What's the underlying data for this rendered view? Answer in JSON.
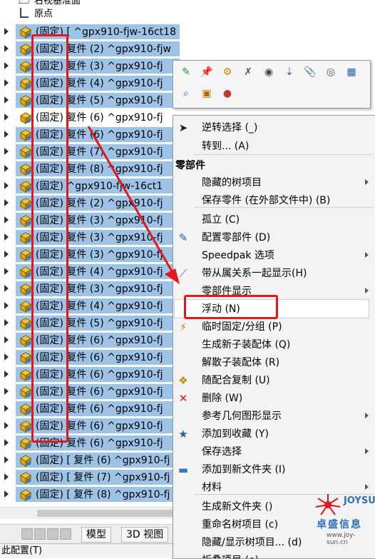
{
  "tree": {
    "top_items": [
      "右视基准面",
      "原点"
    ],
    "rows": [
      {
        "label": "(固定) [ ^gpx910-fjw-16ct18",
        "selected": true
      },
      {
        "label": "(固定)   复件 (2) ^gpx910-fjw",
        "selected": true
      },
      {
        "label": "(固定)   复件 (3) ^gpx910-fj",
        "selected": true
      },
      {
        "label": "(固定)   复件 (4) ^gpx910-fj",
        "selected": true
      },
      {
        "label": "(固定)   复件 (5) ^gpx910-fj",
        "selected": true
      },
      {
        "label": "(固定)   复件 (6) ^gpx910-fj",
        "selected": false
      },
      {
        "label": "(固定)   复件 (6) ^gpx910-fj",
        "selected": true
      },
      {
        "label": "(固定)   复件 (7) ^gpx910-fj",
        "selected": true
      },
      {
        "label": "(固定)   复件 (8) ^gpx910-fj",
        "selected": true
      },
      {
        "label": "(固定)   ^gpx910-fjw-16ct1",
        "selected": true
      },
      {
        "label": "(固定)   复件 (2) ^gpx910-fj",
        "selected": true
      },
      {
        "label": "(固定)   复件 (3) ^gpx910-fj",
        "selected": true
      },
      {
        "label": "(固定)   复件 (3) ^gpx910-fj",
        "selected": true
      },
      {
        "label": "(固定)   复件 (3) ^gpx910-fj",
        "selected": true
      },
      {
        "label": "(固定)   复件 (4) ^gpx910-fj",
        "selected": true
      },
      {
        "label": "(固定)   复件 (3) ^gpx910-fj",
        "selected": true
      },
      {
        "label": "(固定)   复件 (4) ^gpx910-fj",
        "selected": true
      },
      {
        "label": "(固定)   复件 (5) ^gpx910-fj",
        "selected": true
      },
      {
        "label": "(固定)   复件 (6) ^gpx910-fj",
        "selected": true
      },
      {
        "label": "(固定)   复件 (6) ^gpx910-fj",
        "selected": true
      },
      {
        "label": "(固定)   复件 (6) ^gpx910-fj",
        "selected": true
      },
      {
        "label": "(固定)   复件 (6) ^gpx910-fj",
        "selected": true
      },
      {
        "label": "(固定)   复件 (6) ^gpx910-fj",
        "selected": true
      },
      {
        "label": "(固定)   复件 (6) ^gpx910-fj",
        "selected": true
      },
      {
        "label": "(固定)   复件 (6) ^gpx910-fj",
        "selected": true
      },
      {
        "label": "(固定) [ 复件 (6) ^gpx910-fj",
        "selected": true
      },
      {
        "label": "(固定) [ 复件 (7) ^gpx910-fj",
        "selected": true
      },
      {
        "label": "(固定) [ 复件 (8) ^gpx910-fj",
        "selected": true
      }
    ]
  },
  "tabs": {
    "model": "模型",
    "view3d": "3D 视图"
  },
  "status": "此配置(T)",
  "toolbar": {
    "icons": [
      "edit-part-icon",
      "pin-icon",
      "component-props-icon",
      "hide-icon",
      "show-icon",
      "isolate-icon",
      "paperclip-icon",
      "visibility-icon",
      "table-icon",
      "zoom-icon",
      "open-part-icon",
      "appearance-icon"
    ]
  },
  "menu": {
    "header": "零部件",
    "items": [
      {
        "label": "逆转选择 (_)",
        "icon": "cursor-icon",
        "sub": false
      },
      {
        "label": "转到... (A)",
        "icon": "",
        "sub": false
      },
      {
        "label": "隐藏的树项目",
        "icon": "",
        "sub": true
      },
      {
        "label": "保存零件 (在外部文件中) (B)",
        "icon": "",
        "sub": false
      },
      {
        "label": "孤立 (C)",
        "icon": "",
        "sub": false
      },
      {
        "label": "配置零部件 (D)",
        "icon": "configure-icon",
        "sub": false
      },
      {
        "label": "Speedpak 选项",
        "icon": "",
        "sub": true
      },
      {
        "label": "带从属关系一起显示(H)",
        "icon": "show-with-mates-icon",
        "sub": false
      },
      {
        "label": "零部件显示",
        "icon": "",
        "sub": true
      },
      {
        "label": "浮动 (N)",
        "icon": "",
        "sub": false
      },
      {
        "label": "临时固定/分组 (P)",
        "icon": "temp-fix-icon",
        "sub": false
      },
      {
        "label": "生成新子装配体 (Q)",
        "icon": "",
        "sub": false
      },
      {
        "label": "解散子装配体 (R)",
        "icon": "",
        "sub": false
      },
      {
        "label": "随配合复制 (U)",
        "icon": "copy-with-mates-icon",
        "sub": false
      },
      {
        "label": "删除 (W)",
        "icon": "delete-icon",
        "sub": false
      },
      {
        "label": "参考几何图形显示",
        "icon": "",
        "sub": true
      },
      {
        "label": "添加到收藏 (Y)",
        "icon": "favorite-icon",
        "sub": false
      },
      {
        "label": "保存选择",
        "icon": "",
        "sub": true
      },
      {
        "label": "添加到新文件夹 (I)",
        "icon": "folder-icon",
        "sub": false
      },
      {
        "label": "材料",
        "icon": "",
        "sub": true
      },
      {
        "label": "生成新文件夹 ()",
        "icon": "",
        "sub": false
      },
      {
        "label": "重命名树项目 (c)",
        "icon": "",
        "sub": false
      },
      {
        "label": "隐藏/显示树项目... (d)",
        "icon": "",
        "sub": false
      },
      {
        "label": "折叠项目 (e)",
        "icon": "",
        "sub": false
      }
    ]
  },
  "watermark": {
    "brand": "JOYSUN",
    "cn": "卓盛信息",
    "url": "www.joy-sun.cn"
  },
  "colors": {
    "selection": "#9dc3e6",
    "annotation": "#e4171b"
  }
}
